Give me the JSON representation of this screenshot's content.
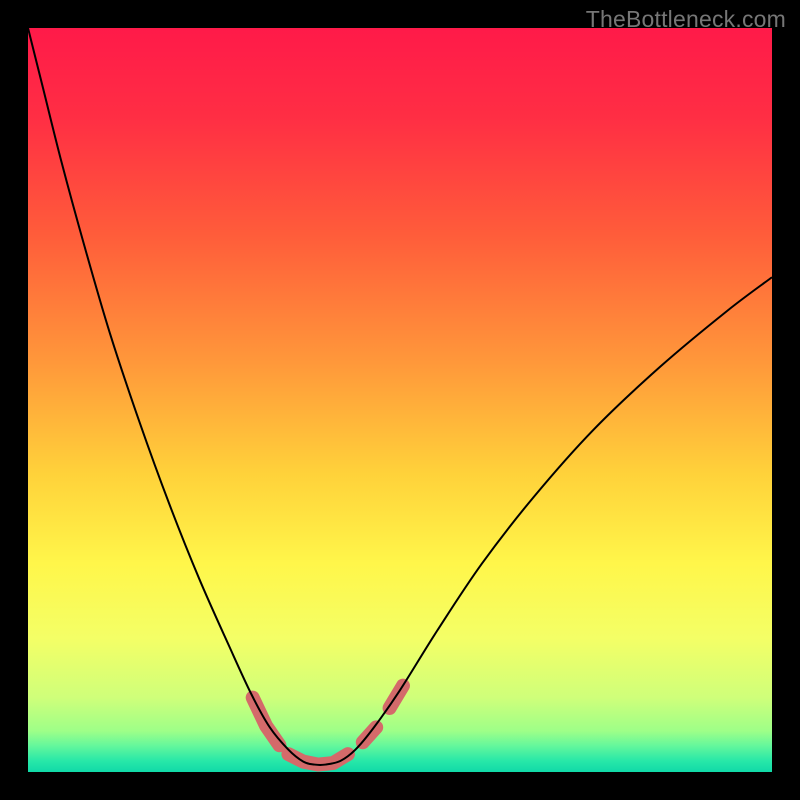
{
  "watermark": {
    "text": "TheBottleneck.com"
  },
  "chart_data": {
    "type": "line",
    "title": "",
    "xlabel": "",
    "ylabel": "",
    "xlim": [
      0,
      100
    ],
    "ylim": [
      0,
      100
    ],
    "grid": false,
    "legend": false,
    "background": {
      "type": "vertical-gradient",
      "stops": [
        {
          "pos": 0.0,
          "color": "#ff1a49"
        },
        {
          "pos": 0.12,
          "color": "#ff2e44"
        },
        {
          "pos": 0.28,
          "color": "#ff5d3a"
        },
        {
          "pos": 0.45,
          "color": "#ff983a"
        },
        {
          "pos": 0.6,
          "color": "#ffd23a"
        },
        {
          "pos": 0.72,
          "color": "#fff64a"
        },
        {
          "pos": 0.82,
          "color": "#f4ff66"
        },
        {
          "pos": 0.9,
          "color": "#cfff7a"
        },
        {
          "pos": 0.945,
          "color": "#9eff88"
        },
        {
          "pos": 0.965,
          "color": "#63f79c"
        },
        {
          "pos": 0.985,
          "color": "#28e8a8"
        },
        {
          "pos": 1.0,
          "color": "#10d9a8"
        }
      ]
    },
    "series": [
      {
        "name": "bottleneck-curve",
        "color": "#000000",
        "stroke_width": 2,
        "x": [
          0.0,
          2.0,
          4.5,
          7.5,
          11.0,
          15.0,
          19.0,
          23.0,
          27.0,
          30.0,
          32.5,
          35.0,
          37.0,
          38.5,
          40.0,
          42.0,
          44.0,
          46.5,
          50.0,
          55.0,
          61.0,
          68.0,
          76.0,
          85.0,
          94.0,
          100.0
        ],
        "y": [
          100.0,
          92.0,
          82.0,
          71.0,
          59.0,
          47.0,
          36.0,
          26.0,
          17.0,
          10.5,
          6.0,
          3.0,
          1.4,
          1.0,
          1.0,
          1.5,
          3.0,
          6.0,
          11.0,
          19.0,
          28.0,
          37.0,
          46.0,
          54.5,
          62.0,
          66.5
        ]
      }
    ],
    "highlight_segments": {
      "name": "curve-highlight-dots",
      "color": "#d46a6a",
      "stroke_width": 14,
      "segments": [
        {
          "x": [
            30.2,
            32.0,
            33.8
          ],
          "y": [
            10.0,
            6.2,
            3.6
          ]
        },
        {
          "x": [
            35.0,
            37.0,
            39.0,
            41.0,
            43.0
          ],
          "y": [
            2.4,
            1.4,
            1.0,
            1.2,
            2.4
          ]
        },
        {
          "x": [
            45.0,
            46.8
          ],
          "y": [
            4.0,
            6.0
          ]
        },
        {
          "x": [
            48.6,
            50.4
          ],
          "y": [
            8.6,
            11.6
          ]
        }
      ]
    }
  }
}
